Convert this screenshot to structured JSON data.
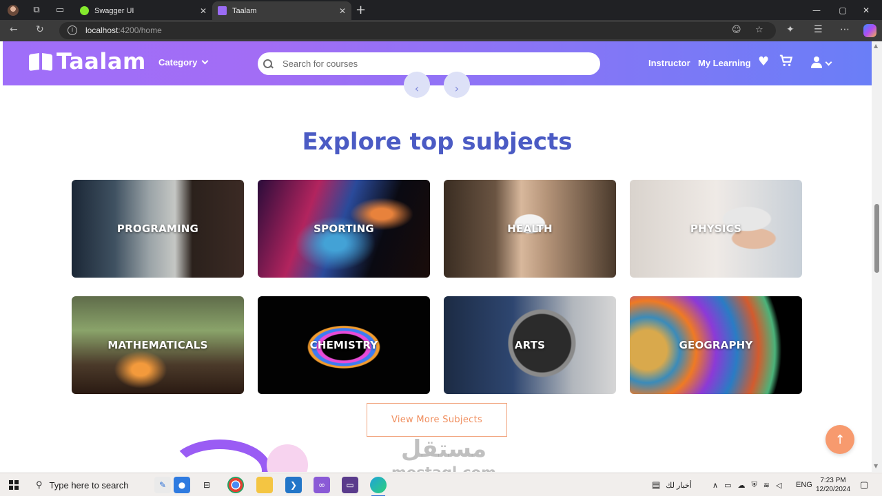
{
  "browser": {
    "tabs": [
      {
        "title": "Swagger UI",
        "favicon_color": "#85ea2d"
      },
      {
        "title": "Taalam",
        "favicon_color": "#9b6cf5"
      }
    ],
    "url_host": "localhost",
    "url_path": ":4200/home"
  },
  "header": {
    "logo_text": "Taalam",
    "category_label": "Category",
    "search_placeholder": "Search for courses",
    "instructor_label": "Instructor",
    "my_learning_label": "My Learning"
  },
  "carousel": {
    "prev_icon": "‹",
    "next_icon": "›"
  },
  "section": {
    "title": "Explore top subjects",
    "subjects": [
      {
        "label": "PROGRAMING"
      },
      {
        "label": "SPORTING"
      },
      {
        "label": "HEALTH"
      },
      {
        "label": "PHYSICS"
      },
      {
        "label": "MATHEMATICALS"
      },
      {
        "label": "CHEMISTRY"
      },
      {
        "label": "ARTS"
      },
      {
        "label": "GEOGRAPHY"
      }
    ],
    "view_more_label": "View More Subjects"
  },
  "watermark": {
    "arabic": "مستقل",
    "latin": "mostaql.com"
  },
  "taskbar": {
    "search_placeholder": "Type here to search",
    "news_label": "أخبار لك",
    "language": "ENG",
    "time": "7:23 PM",
    "date": "12/20/2024"
  },
  "colors": {
    "header_gradient_start": "#9f6ef9",
    "header_gradient_end": "#6a7ef7",
    "title_color": "#4b5bc4",
    "accent_orange": "#f08e5e"
  }
}
